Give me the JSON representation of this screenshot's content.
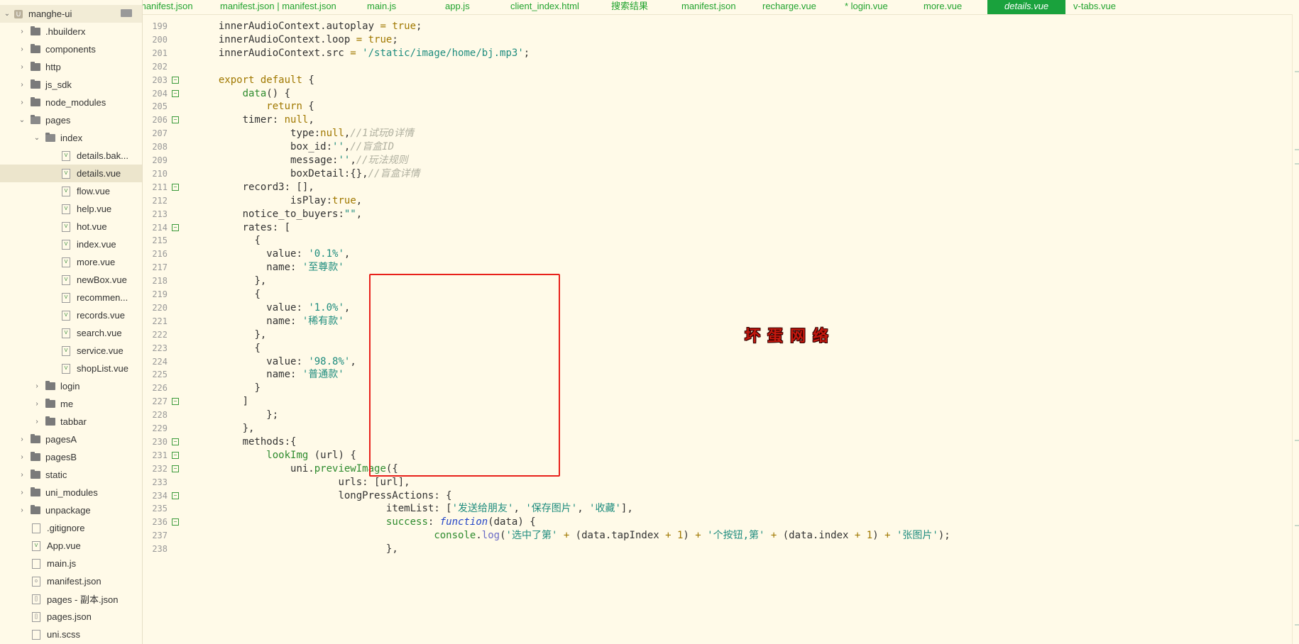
{
  "project": {
    "name": "manghe-ui"
  },
  "tree": [
    {
      "label": "manghe-ui",
      "type": "root",
      "depth": 0,
      "expanded": true
    },
    {
      "label": ".hbuilderx",
      "type": "folder",
      "depth": 1,
      "expanded": false
    },
    {
      "label": "components",
      "type": "folder",
      "depth": 1,
      "expanded": false
    },
    {
      "label": "http",
      "type": "folder",
      "depth": 1,
      "expanded": false
    },
    {
      "label": "js_sdk",
      "type": "folder",
      "depth": 1,
      "expanded": false
    },
    {
      "label": "node_modules",
      "type": "folder",
      "depth": 1,
      "expanded": false
    },
    {
      "label": "pages",
      "type": "folder",
      "depth": 1,
      "expanded": true
    },
    {
      "label": "index",
      "type": "folder",
      "depth": 2,
      "expanded": true
    },
    {
      "label": "details.bak...",
      "type": "vue",
      "depth": 3
    },
    {
      "label": "details.vue",
      "type": "vue",
      "depth": 3,
      "selected": true
    },
    {
      "label": "flow.vue",
      "type": "vue",
      "depth": 3
    },
    {
      "label": "help.vue",
      "type": "vue",
      "depth": 3
    },
    {
      "label": "hot.vue",
      "type": "vue",
      "depth": 3
    },
    {
      "label": "index.vue",
      "type": "vue",
      "depth": 3
    },
    {
      "label": "more.vue",
      "type": "vue",
      "depth": 3
    },
    {
      "label": "newBox.vue",
      "type": "vue",
      "depth": 3
    },
    {
      "label": "recommen...",
      "type": "vue",
      "depth": 3
    },
    {
      "label": "records.vue",
      "type": "vue",
      "depth": 3
    },
    {
      "label": "search.vue",
      "type": "vue",
      "depth": 3
    },
    {
      "label": "service.vue",
      "type": "vue",
      "depth": 3
    },
    {
      "label": "shopList.vue",
      "type": "vue",
      "depth": 3
    },
    {
      "label": "login",
      "type": "folder",
      "depth": 2,
      "expanded": false
    },
    {
      "label": "me",
      "type": "folder",
      "depth": 2,
      "expanded": false
    },
    {
      "label": "tabbar",
      "type": "folder",
      "depth": 2,
      "expanded": false
    },
    {
      "label": "pagesA",
      "type": "folder",
      "depth": 1,
      "expanded": false
    },
    {
      "label": "pagesB",
      "type": "folder",
      "depth": 1,
      "expanded": false
    },
    {
      "label": "static",
      "type": "folder",
      "depth": 1,
      "expanded": false
    },
    {
      "label": "uni_modules",
      "type": "folder",
      "depth": 1,
      "expanded": false
    },
    {
      "label": "unpackage",
      "type": "folder",
      "depth": 1,
      "expanded": false
    },
    {
      "label": ".gitignore",
      "type": "file",
      "depth": 1
    },
    {
      "label": "App.vue",
      "type": "vue",
      "depth": 1
    },
    {
      "label": "main.js",
      "type": "file",
      "depth": 1
    },
    {
      "label": "manifest.json",
      "type": "json",
      "depth": 1
    },
    {
      "label": "pages - 副本.json",
      "type": "bracket",
      "depth": 1
    },
    {
      "label": "pages.json",
      "type": "bracket",
      "depth": 1
    },
    {
      "label": "uni.scss",
      "type": "file",
      "depth": 1
    }
  ],
  "tabs": [
    {
      "label": "manifest.json",
      "active": false
    },
    {
      "label": "manifest.json | manifest.json",
      "active": false
    },
    {
      "label": "main.js",
      "active": false
    },
    {
      "label": "app.js",
      "active": false
    },
    {
      "label": "client_index.html",
      "active": false
    },
    {
      "label": "搜索结果",
      "active": false
    },
    {
      "label": "manifest.json",
      "active": false
    },
    {
      "label": "recharge.vue",
      "active": false
    },
    {
      "label": "* login.vue",
      "active": false
    },
    {
      "label": "more.vue",
      "active": false
    },
    {
      "label": "details.vue",
      "active": true
    },
    {
      "label": "v-tabs.vue",
      "active": false
    }
  ],
  "code_lines": [
    {
      "n": "199",
      "fold": false,
      "indent": 2,
      "tokens": [
        [
          "",
          "innerAudioContext.autoplay "
        ],
        [
          "k",
          "="
        ],
        [
          "",
          " "
        ],
        [
          "k",
          "true"
        ],
        [
          "",
          ";"
        ]
      ]
    },
    {
      "n": "200",
      "fold": false,
      "indent": 2,
      "tokens": [
        [
          "",
          "innerAudioContext.loop "
        ],
        [
          "k",
          "="
        ],
        [
          "",
          " "
        ],
        [
          "k",
          "true"
        ],
        [
          "",
          ";"
        ]
      ]
    },
    {
      "n": "201",
      "fold": false,
      "indent": 2,
      "tokens": [
        [
          "",
          "innerAudioContext.src "
        ],
        [
          "k",
          "="
        ],
        [
          "",
          " "
        ],
        [
          "s",
          "'/static/image/home/bj.mp3'"
        ],
        [
          "",
          ";"
        ]
      ]
    },
    {
      "n": "202",
      "fold": false,
      "indent": 0,
      "tokens": []
    },
    {
      "n": "203",
      "fold": true,
      "indent": 2,
      "tokens": [
        [
          "k",
          "export"
        ],
        [
          "",
          " "
        ],
        [
          "k",
          "default"
        ],
        [
          "",
          " {"
        ]
      ]
    },
    {
      "n": "204",
      "fold": true,
      "indent": 6,
      "tokens": [
        [
          "f",
          "data"
        ],
        [
          "",
          "() {"
        ]
      ]
    },
    {
      "n": "205",
      "fold": false,
      "indent": 10,
      "tokens": [
        [
          "k",
          "return"
        ],
        [
          "",
          " {"
        ]
      ]
    },
    {
      "n": "206",
      "fold": true,
      "indent": 6,
      "tokens": [
        [
          "",
          "timer: "
        ],
        [
          "k",
          "null"
        ],
        [
          "",
          ","
        ]
      ]
    },
    {
      "n": "207",
      "fold": false,
      "indent": 14,
      "tokens": [
        [
          "",
          "type:"
        ],
        [
          "k",
          "null"
        ],
        [
          "",
          ","
        ],
        [
          "c",
          "//1试玩0详情"
        ]
      ]
    },
    {
      "n": "208",
      "fold": false,
      "indent": 14,
      "tokens": [
        [
          "",
          "box_id:"
        ],
        [
          "s",
          "''"
        ],
        [
          "",
          ","
        ],
        [
          "c",
          "//盲盒ID"
        ]
      ]
    },
    {
      "n": "209",
      "fold": false,
      "indent": 14,
      "tokens": [
        [
          "",
          "message:"
        ],
        [
          "s",
          "''"
        ],
        [
          "",
          ","
        ],
        [
          "c",
          "//玩法规则"
        ]
      ]
    },
    {
      "n": "210",
      "fold": false,
      "indent": 14,
      "tokens": [
        [
          "",
          "boxDetail:{},"
        ],
        [
          "c",
          "//盲盒详情"
        ]
      ]
    },
    {
      "n": "211",
      "fold": true,
      "indent": 6,
      "tokens": [
        [
          "",
          "record3: [],"
        ]
      ]
    },
    {
      "n": "212",
      "fold": false,
      "indent": 14,
      "tokens": [
        [
          "",
          "isPlay:"
        ],
        [
          "k",
          "true"
        ],
        [
          "",
          ","
        ]
      ]
    },
    {
      "n": "213",
      "fold": false,
      "indent": 6,
      "tokens": [
        [
          "",
          "notice_to_buyers:"
        ],
        [
          "s",
          "\"\""
        ],
        [
          "",
          ","
        ]
      ]
    },
    {
      "n": "214",
      "fold": true,
      "indent": 6,
      "tokens": [
        [
          "",
          "rates: ["
        ]
      ]
    },
    {
      "n": "215",
      "fold": false,
      "indent": 8,
      "tokens": [
        [
          "",
          "{"
        ]
      ]
    },
    {
      "n": "216",
      "fold": false,
      "indent": 10,
      "tokens": [
        [
          "",
          "value: "
        ],
        [
          "s",
          "'0.1%'"
        ],
        [
          "",
          ","
        ]
      ]
    },
    {
      "n": "217",
      "fold": false,
      "indent": 10,
      "tokens": [
        [
          "",
          "name: "
        ],
        [
          "s",
          "'至尊款'"
        ]
      ]
    },
    {
      "n": "218",
      "fold": false,
      "indent": 8,
      "tokens": [
        [
          "",
          "},"
        ]
      ]
    },
    {
      "n": "219",
      "fold": false,
      "indent": 8,
      "tokens": [
        [
          "",
          "{"
        ]
      ]
    },
    {
      "n": "220",
      "fold": false,
      "indent": 10,
      "tokens": [
        [
          "",
          "value: "
        ],
        [
          "s",
          "'1.0%'"
        ],
        [
          "",
          ","
        ]
      ]
    },
    {
      "n": "221",
      "fold": false,
      "indent": 10,
      "tokens": [
        [
          "",
          "name: "
        ],
        [
          "s",
          "'稀有款'"
        ]
      ]
    },
    {
      "n": "222",
      "fold": false,
      "indent": 8,
      "tokens": [
        [
          "",
          "},"
        ]
      ]
    },
    {
      "n": "223",
      "fold": false,
      "indent": 8,
      "tokens": [
        [
          "",
          "{"
        ]
      ]
    },
    {
      "n": "224",
      "fold": false,
      "indent": 10,
      "tokens": [
        [
          "",
          "value: "
        ],
        [
          "s",
          "'98.8%'"
        ],
        [
          "",
          ","
        ]
      ]
    },
    {
      "n": "225",
      "fold": false,
      "indent": 10,
      "tokens": [
        [
          "",
          "name: "
        ],
        [
          "s",
          "'普通款'"
        ]
      ]
    },
    {
      "n": "226",
      "fold": false,
      "indent": 8,
      "tokens": [
        [
          "",
          "}"
        ]
      ]
    },
    {
      "n": "227",
      "fold": true,
      "indent": 6,
      "tokens": [
        [
          "",
          "]"
        ]
      ]
    },
    {
      "n": "228",
      "fold": false,
      "indent": 10,
      "tokens": [
        [
          "",
          "};"
        ]
      ]
    },
    {
      "n": "229",
      "fold": false,
      "indent": 6,
      "tokens": [
        [
          "",
          "},"
        ]
      ]
    },
    {
      "n": "230",
      "fold": true,
      "indent": 6,
      "tokens": [
        [
          "",
          "methods:{"
        ]
      ]
    },
    {
      "n": "231",
      "fold": true,
      "indent": 10,
      "tokens": [
        [
          "f",
          "lookImg"
        ],
        [
          "",
          " (url) {"
        ]
      ]
    },
    {
      "n": "232",
      "fold": true,
      "indent": 14,
      "tokens": [
        [
          "",
          "uni."
        ],
        [
          "f",
          "previewImage"
        ],
        [
          "",
          "({"
        ]
      ]
    },
    {
      "n": "233",
      "fold": false,
      "indent": 22,
      "tokens": [
        [
          "",
          "urls: [url],"
        ]
      ]
    },
    {
      "n": "234",
      "fold": true,
      "indent": 22,
      "tokens": [
        [
          "",
          "longPressActions: {"
        ]
      ]
    },
    {
      "n": "235",
      "fold": false,
      "indent": 30,
      "tokens": [
        [
          "",
          "itemList: ["
        ],
        [
          "s",
          "'发送给朋友'"
        ],
        [
          "",
          ", "
        ],
        [
          "s",
          "'保存图片'"
        ],
        [
          "",
          ", "
        ],
        [
          "s",
          "'收藏'"
        ],
        [
          "",
          "],"
        ]
      ]
    },
    {
      "n": "236",
      "fold": true,
      "indent": 30,
      "tokens": [
        [
          "f",
          "success"
        ],
        [
          "",
          ": "
        ],
        [
          "i",
          "function"
        ],
        [
          "",
          "(data) {"
        ]
      ]
    },
    {
      "n": "237",
      "fold": false,
      "indent": 38,
      "tokens": [
        [
          "f",
          "console"
        ],
        [
          "",
          "."
        ],
        [
          "n",
          "log"
        ],
        [
          "",
          "("
        ],
        [
          "s",
          "'选中了第'"
        ],
        [
          "",
          " "
        ],
        [
          "k",
          "+"
        ],
        [
          "",
          " (data.tapIndex "
        ],
        [
          "k",
          "+"
        ],
        [
          "",
          " "
        ],
        [
          "k",
          "1"
        ],
        [
          "",
          ") "
        ],
        [
          "k",
          "+"
        ],
        [
          "",
          " "
        ],
        [
          "s",
          "'个按钮,第'"
        ],
        [
          "",
          " "
        ],
        [
          "k",
          "+"
        ],
        [
          "",
          " (data.index "
        ],
        [
          "k",
          "+"
        ],
        [
          "",
          " "
        ],
        [
          "k",
          "1"
        ],
        [
          "",
          ") "
        ],
        [
          "k",
          "+"
        ],
        [
          "",
          " "
        ],
        [
          "s",
          "'张图片'"
        ],
        [
          "",
          ");"
        ]
      ]
    },
    {
      "n": "238",
      "fold": false,
      "indent": 30,
      "tokens": [
        [
          "",
          "},"
        ]
      ]
    }
  ],
  "watermark": {
    "text": "坏蛋网络",
    "color": "#c2180e"
  },
  "colors": {
    "accent": "#1aa23d",
    "tab_text": "#22a32e",
    "highlight_box": "#e8201a",
    "editor_bg": "#fffae8"
  }
}
